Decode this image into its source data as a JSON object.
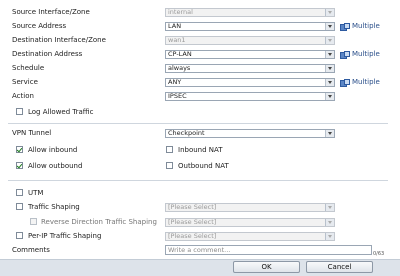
{
  "form": {
    "source_interface": {
      "label": "Source Interface/Zone",
      "value": "internal"
    },
    "source_address": {
      "label": "Source Address",
      "value": "LAN",
      "multiple": "Multiple"
    },
    "destination_interface": {
      "label": "Destination Interface/Zone",
      "value": "wan1"
    },
    "destination_address": {
      "label": "Destination Address",
      "value": "CP-LAN",
      "multiple": "Multiple"
    },
    "schedule": {
      "label": "Schedule",
      "value": "always"
    },
    "service": {
      "label": "Service",
      "value": "ANY",
      "multiple": "Multiple"
    },
    "action": {
      "label": "Action",
      "value": "IPSEC"
    },
    "log_allowed": {
      "label": "Log Allowed Traffic",
      "checked": false
    }
  },
  "vpn": {
    "tunnel": {
      "label": "VPN Tunnel",
      "value": "Checkpoint"
    },
    "allow_inbound": {
      "label": "Allow inbound",
      "checked": true
    },
    "inbound_nat": {
      "label": "Inbound NAT",
      "checked": false
    },
    "allow_outbound": {
      "label": "Allow outbound",
      "checked": true
    },
    "outbound_nat": {
      "label": "Outbound NAT",
      "checked": false
    }
  },
  "advanced": {
    "utm": {
      "label": "UTM",
      "checked": false
    },
    "traffic_shaping": {
      "label": "Traffic Shaping",
      "value": "[Please Select]",
      "checked": false
    },
    "reverse_shaping": {
      "label": "Reverse Direction Traffic Shaping",
      "value": "[Please Select]",
      "checked": false
    },
    "per_ip_shaping": {
      "label": "Per-IP Traffic Shaping",
      "value": "[Please Select]",
      "checked": false
    },
    "comments": {
      "label": "Comments",
      "placeholder": "Write a comment...",
      "counter": "0/63"
    }
  },
  "footer": {
    "ok": "OK",
    "cancel": "Cancel"
  }
}
